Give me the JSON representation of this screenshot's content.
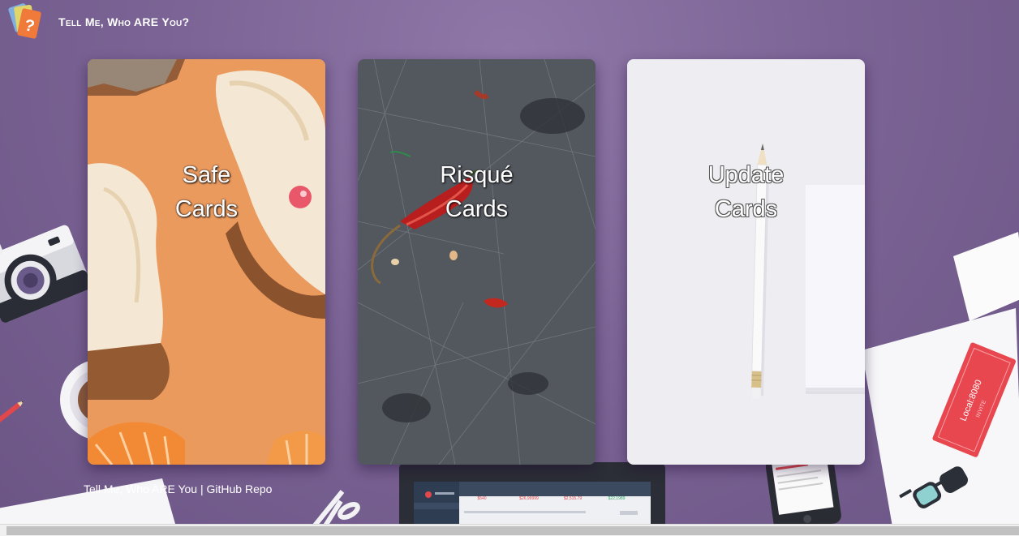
{
  "header": {
    "brand": "Tell Me, Who ARE You?",
    "logo_icon": "question-cards-logo-icon"
  },
  "cards": [
    {
      "id": "safe",
      "line1": "Safe",
      "line2": "Cards",
      "background": "orange-peel-photo"
    },
    {
      "id": "risque",
      "line1": "Risqué",
      "line2": "Cards",
      "background": "chili-pepper-on-slate-photo"
    },
    {
      "id": "update",
      "line1": "Update",
      "line2": "Cards",
      "background": "pencil-on-white-photo"
    }
  ],
  "footer": {
    "site_link": "Tell Me, Who ARE You",
    "separator": " | ",
    "repo_link": "GitHub Repo"
  },
  "decor": {
    "ticket_text": "Local:8080",
    "ticket_stamp": "INVITE",
    "laptop_stats": [
      "$540",
      "$26,99999",
      "$2,515.79",
      "$22,1989"
    ]
  },
  "colors": {
    "background": "#7c6596",
    "card_safe": "#e8965a",
    "card_risque": "#4a4f55",
    "card_update": "#eeeef2",
    "ticket": "#e8474f"
  }
}
